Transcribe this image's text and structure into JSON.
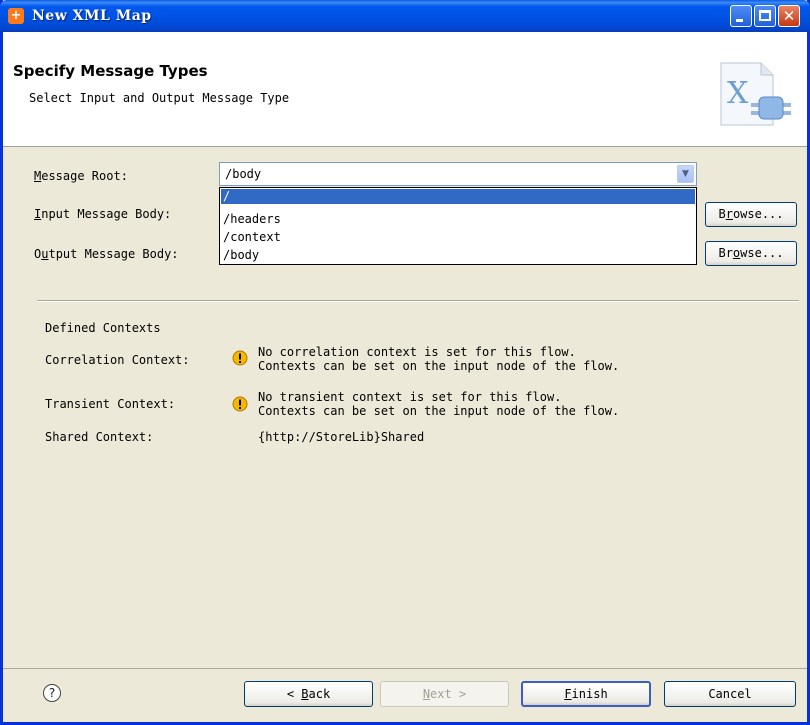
{
  "window": {
    "title": "New XML Map"
  },
  "header": {
    "title": "Specify Message Types",
    "subtitle": "Select Input and Output Message Type"
  },
  "form": {
    "message_root": {
      "label": "Message Root:",
      "value": "/body",
      "options": [
        "/",
        "/headers",
        "/context",
        "/body"
      ],
      "selected_index": 0
    },
    "input_body": {
      "label": "Input Message Body:",
      "browse": "Browse..."
    },
    "output_body": {
      "label": "Output Message Body:",
      "browse": "Browse..."
    }
  },
  "contexts": {
    "heading": "Defined Contexts",
    "correlation": {
      "label": "Correlation Context:",
      "line1": "No correlation context is set for this flow.",
      "line2": "Contexts can be set on the input node of the flow."
    },
    "transient": {
      "label": "Transient Context:",
      "line1": "No transient context is set for this flow.",
      "line2": "Contexts can be set on the input node of the flow."
    },
    "shared": {
      "label": "Shared Context:",
      "value": "{http://StoreLib}Shared"
    }
  },
  "footer": {
    "back": "< Back",
    "next": "Next >",
    "finish": "Finish",
    "cancel": "Cancel",
    "help": "?"
  },
  "colors": {
    "titlebar": "#0054e3",
    "selection": "#316ac5",
    "dialog_bg": "#ece9d8",
    "warning": "#f0b000"
  }
}
